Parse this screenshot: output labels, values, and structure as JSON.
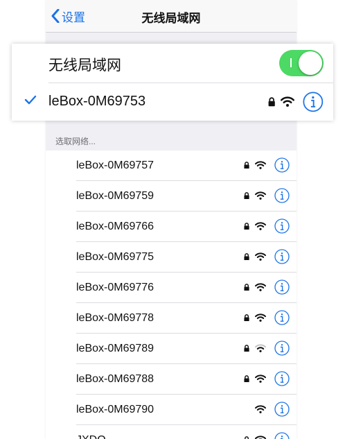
{
  "navbar": {
    "back_label": "设置",
    "title": "无线局域网"
  },
  "wifi_card": {
    "title": "无线局域网",
    "toggle_on": true,
    "connected": {
      "ssid": "leBox-0M69753",
      "locked": true,
      "signal": "full"
    }
  },
  "section_header": "选取网络...",
  "networks": [
    {
      "ssid": "leBox-0M69757",
      "locked": true,
      "signal": "full"
    },
    {
      "ssid": "leBox-0M69759",
      "locked": true,
      "signal": "full"
    },
    {
      "ssid": "leBox-0M69766",
      "locked": true,
      "signal": "full"
    },
    {
      "ssid": "leBox-0M69775",
      "locked": true,
      "signal": "full"
    },
    {
      "ssid": "leBox-0M69776",
      "locked": true,
      "signal": "full"
    },
    {
      "ssid": "leBox-0M69778",
      "locked": true,
      "signal": "full"
    },
    {
      "ssid": "leBox-0M69789",
      "locked": true,
      "signal": "weak"
    },
    {
      "ssid": "leBox-0M69788",
      "locked": true,
      "signal": "full"
    },
    {
      "ssid": "leBox-0M69790",
      "locked": false,
      "signal": "full"
    },
    {
      "ssid": "JXDO",
      "locked": true,
      "signal": "full"
    }
  ],
  "colors": {
    "accent": "#1a73e8",
    "toggle_on": "#4cd964",
    "background": "#efeff4"
  }
}
